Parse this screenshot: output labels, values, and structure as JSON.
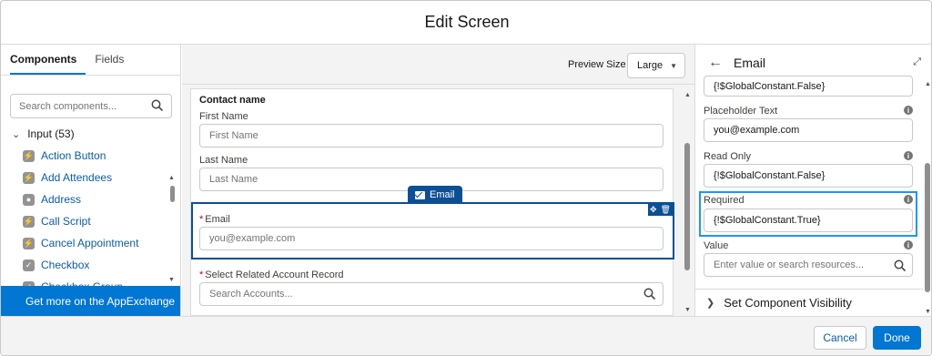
{
  "header": {
    "title": "Edit Screen"
  },
  "left_panel": {
    "tabs": [
      {
        "label": "Components",
        "active": true
      },
      {
        "label": "Fields",
        "active": false
      }
    ],
    "search_placeholder": "Search components...",
    "group": {
      "label": "Input (53)",
      "expanded": true
    },
    "components": [
      {
        "label": "Action Button",
        "icon": "bolt-icon"
      },
      {
        "label": "Add Attendees",
        "icon": "bolt-icon"
      },
      {
        "label": "Address",
        "icon": "location-pin-icon"
      },
      {
        "label": "Call Script",
        "icon": "bolt-icon"
      },
      {
        "label": "Cancel Appointment",
        "icon": "bolt-icon"
      },
      {
        "label": "Checkbox",
        "icon": "checkbox-icon"
      },
      {
        "label": "Checkbox Group",
        "icon": "checkbox-icon"
      }
    ],
    "appexchange_label": "Get more on the AppExchange"
  },
  "canvas": {
    "preview_label": "Preview Size",
    "preview_value": "Large",
    "section_title": "Contact name",
    "first_name_label": "First Name",
    "first_name_placeholder": "First Name",
    "last_name_label": "Last Name",
    "last_name_placeholder": "Last Name",
    "email_tag": "Email",
    "email_label": "Email",
    "email_placeholder": "you@example.com",
    "account_label": "Select Related Account Record",
    "account_placeholder": "Search Accounts..."
  },
  "properties": {
    "title": "Email",
    "top_value": "{!$GlobalConstant.False}",
    "placeholder_label": "Placeholder Text",
    "placeholder_value": "you@example.com",
    "readonly_label": "Read Only",
    "readonly_value": "{!$GlobalConstant.False}",
    "required_label": "Required",
    "required_value": "{!$GlobalConstant.True}",
    "value_label": "Value",
    "value_placeholder": "Enter value or search resources...",
    "visibility_label": "Set Component Visibility"
  },
  "footer": {
    "cancel_label": "Cancel",
    "done_label": "Done"
  },
  "colors": {
    "brand": "#0176d3",
    "selected_border": "#0b4f94",
    "focus_border": "#1b96ff"
  }
}
